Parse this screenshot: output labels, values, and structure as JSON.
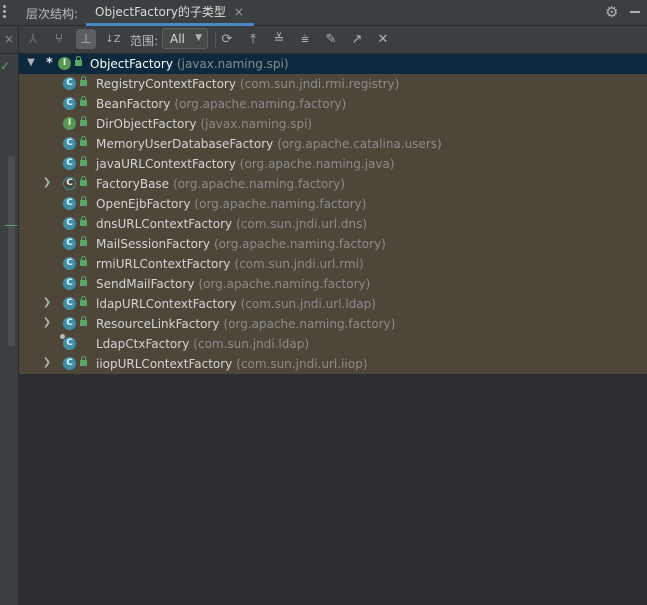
{
  "header": {
    "label": "层次结构:",
    "tab_title": "ObjectFactory的子类型",
    "tab_close": "×"
  },
  "gutter": {
    "close_glyph": "×",
    "check_glyph": "✓"
  },
  "toolbar": {
    "scope_label": "范围:",
    "scope_value": "All",
    "sort_label": "↓Z"
  },
  "tree": {
    "root": {
      "name": "ObjectFactory",
      "package": "(javax.naming.spi)",
      "marker": "*"
    },
    "items": [
      {
        "name": "RegistryContextFactory",
        "package": "(com.sun.jndi.rmi.registry)"
      },
      {
        "name": "BeanFactory",
        "package": "(org.apache.naming.factory)"
      },
      {
        "name": "DirObjectFactory",
        "package": "(javax.naming.spi)"
      },
      {
        "name": "MemoryUserDatabaseFactory",
        "package": "(org.apache.catalina.users)"
      },
      {
        "name": "javaURLContextFactory",
        "package": "(org.apache.naming.java)"
      },
      {
        "name": "FactoryBase",
        "package": "(org.apache.naming.factory)"
      },
      {
        "name": "OpenEjbFactory",
        "package": "(org.apache.naming.factory)"
      },
      {
        "name": "dnsURLContextFactory",
        "package": "(com.sun.jndi.url.dns)"
      },
      {
        "name": "MailSessionFactory",
        "package": "(org.apache.naming.factory)"
      },
      {
        "name": "rmiURLContextFactory",
        "package": "(com.sun.jndi.url.rmi)"
      },
      {
        "name": "SendMailFactory",
        "package": "(org.apache.naming.factory)"
      },
      {
        "name": "ldapURLContextFactory",
        "package": "(com.sun.jndi.url.ldap)"
      },
      {
        "name": "ResourceLinkFactory",
        "package": "(org.apache.naming.factory)"
      },
      {
        "name": "LdapCtxFactory",
        "package": "(com.sun.jndi.ldap)"
      },
      {
        "name": "iiopURLContextFactory",
        "package": "(com.sun.jndi.url.iiop)"
      }
    ]
  },
  "icons": {
    "class_letter": "C",
    "interface_letter": "I"
  }
}
